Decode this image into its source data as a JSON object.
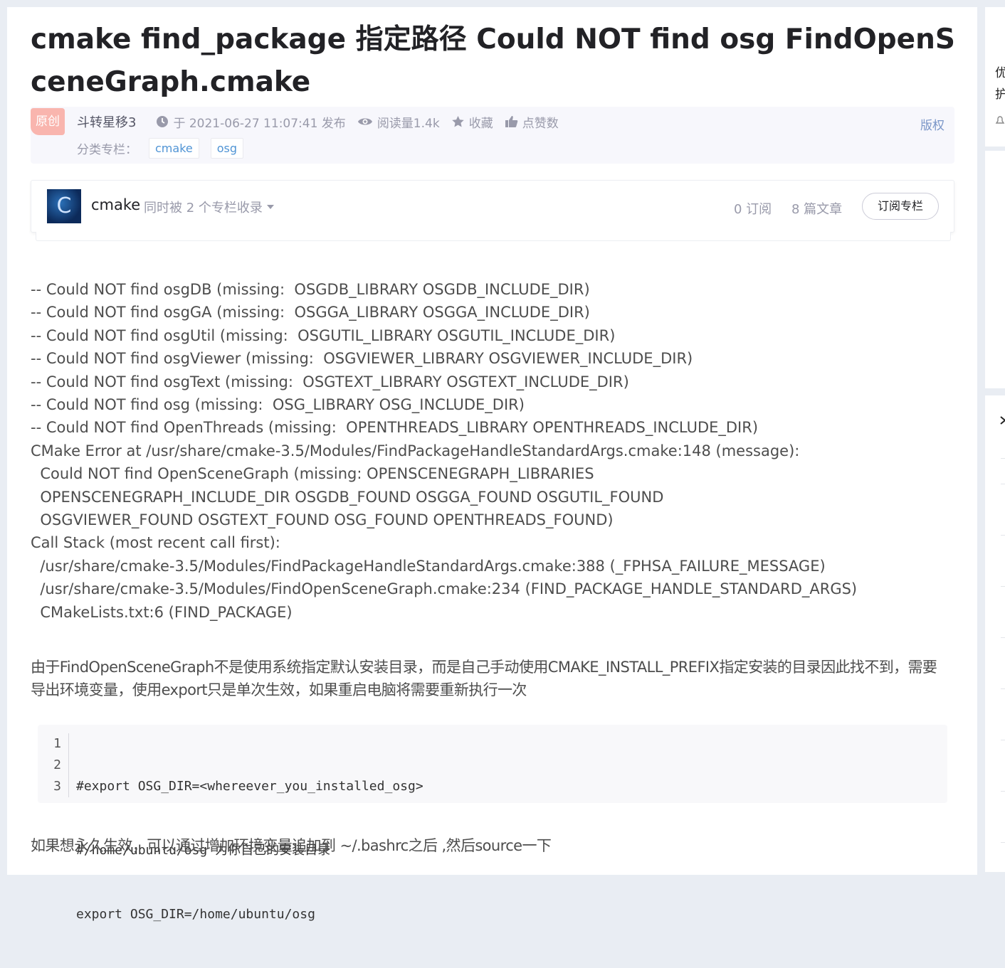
{
  "article": {
    "title": "cmake find_package 指定路径 Could NOT find osg FindOpenSceneGraph.cmake",
    "badge": "原创",
    "author": "斗转星移3",
    "publish": "于 2021-06-27 11:07:41 发布",
    "reads": "阅读量1.4k",
    "collect": "收藏",
    "likes": "点赞数",
    "copyright": "版权",
    "category_label": "分类专栏：",
    "tags": [
      "cmake",
      "osg"
    ]
  },
  "column": {
    "name": "cmake",
    "also": "同时被 2 个专栏收录",
    "subscribers": "0 订阅",
    "articles": "8 篇文章",
    "subscribe_button": "订阅专栏"
  },
  "log_lines": [
    "-- Could NOT find osgDB (missing:  OSGDB_LIBRARY OSGDB_INCLUDE_DIR)",
    "-- Could NOT find osgGA (missing:  OSGGA_LIBRARY OSGGA_INCLUDE_DIR)",
    "-- Could NOT find osgUtil (missing:  OSGUTIL_LIBRARY OSGUTIL_INCLUDE_DIR)",
    "-- Could NOT find osgViewer (missing:  OSGVIEWER_LIBRARY OSGVIEWER_INCLUDE_DIR)",
    "-- Could NOT find osgText (missing:  OSGTEXT_LIBRARY OSGTEXT_INCLUDE_DIR)",
    "-- Could NOT find osg (missing:  OSG_LIBRARY OSG_INCLUDE_DIR)",
    "-- Could NOT find OpenThreads (missing:  OPENTHREADS_LIBRARY OPENTHREADS_INCLUDE_DIR)",
    "CMake Error at /usr/share/cmake-3.5/Modules/FindPackageHandleStandardArgs.cmake:148 (message):",
    "  Could NOT find OpenSceneGraph (missing: OPENSCENEGRAPH_LIBRARIES",
    "  OPENSCENEGRAPH_INCLUDE_DIR OSGDB_FOUND OSGGA_FOUND OSGUTIL_FOUND",
    "  OSGVIEWER_FOUND OSGTEXT_FOUND OSG_FOUND OPENTHREADS_FOUND)",
    "Call Stack (most recent call first):",
    "  /usr/share/cmake-3.5/Modules/FindPackageHandleStandardArgs.cmake:388 (_FPHSA_FAILURE_MESSAGE)",
    "  /usr/share/cmake-3.5/Modules/FindOpenSceneGraph.cmake:234 (FIND_PACKAGE_HANDLE_STANDARD_ARGS)",
    "  CMakeLists.txt:6 (FIND_PACKAGE)"
  ],
  "explanation": "由于FindOpenSceneGraph不是使用系统指定默认安装目录，而是自己手动使用CMAKE_INSTALL_PREFIX指定安装的目录因此找不到，需要导出环境变量，使用export只是单次生效，如果重启电脑将需要重新执行一次",
  "code": {
    "line_numbers": [
      "1",
      "2",
      "3"
    ],
    "lines": [
      "#export OSG_DIR=<whereever_you_installed_osg>",
      "#/home/ubuntu/osg 为你自己的安装目录",
      "export OSG_DIR=/home/ubuntu/osg"
    ]
  },
  "footer_text": "如果想永久生效，可以通过增加环境变量追加到 ~/.bashrc之后 ,然后source一下",
  "sidebar": {
    "text_1": "优",
    "text_2": "护"
  },
  "colors": {
    "link": "#5094d5",
    "badge": "#f9b5ae",
    "body_text": "#4d4d4d"
  }
}
